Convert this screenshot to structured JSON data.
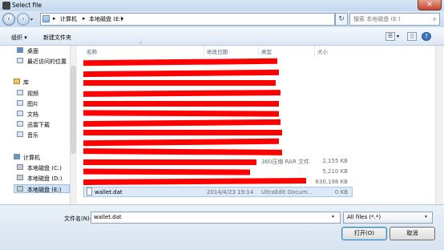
{
  "window": {
    "title": "Select file",
    "close_glyph": "✕"
  },
  "nav": {
    "back_icon": "‹",
    "forward_icon": "›",
    "history_icon": "▾",
    "breadcrumbs": [
      "计算机",
      "本地磁盘 (E:)"
    ],
    "sep": "▸",
    "refresh_icon": "↻",
    "search_placeholder": "搜索 本地磁盘 (E:)",
    "search_icon": "⌕"
  },
  "toolbar": {
    "organize_label": "组织 ▾",
    "new_folder_label": "新建文件夹",
    "view_icon": "☰",
    "view_arrow": "▾",
    "pane_icon": "▯",
    "help_icon": "?"
  },
  "sidebar": {
    "favorites": [
      {
        "label": "桌面",
        "icon": "desktop-icon"
      },
      {
        "label": "最近访问的位置",
        "icon": "recent-places-icon"
      }
    ],
    "libraries_header": "库",
    "libraries": [
      {
        "label": "视频",
        "icon": "video-icon"
      },
      {
        "label": "图片",
        "icon": "pictures-icon"
      },
      {
        "label": "文档",
        "icon": "documents-icon"
      },
      {
        "label": "迅雷下载",
        "icon": "thunder-download-icon"
      },
      {
        "label": "音乐",
        "icon": "music-icon"
      }
    ],
    "computer_header": "计算机",
    "drives": [
      {
        "label": "本地磁盘 (C:)"
      },
      {
        "label": "本地磁盘 (D:)"
      },
      {
        "label": "本地磁盘 (E:)",
        "selected": true
      }
    ]
  },
  "columns": {
    "name": "名称",
    "modified": "修改日期",
    "type": "类型",
    "size": "大小",
    "sort_glyph": "^"
  },
  "files": [
    {
      "name": "",
      "modified": "",
      "type": "360压缩 RAR 文件",
      "size": "2,155 KB"
    },
    {
      "name": "",
      "modified": "",
      "type": "",
      "size": "5,210 KB"
    },
    {
      "name": "",
      "modified": "",
      "type": "",
      "size": "830,198 KB"
    },
    {
      "name": "wallet.dat",
      "modified": "2014/4/23 19:14",
      "type": "UltraEdit Docum...",
      "size": "0 KB",
      "selected": true
    }
  ],
  "bottom": {
    "filename_label": "文件名(N):",
    "filename_value": "wallet.dat",
    "dropdown_arrow": "▾",
    "filetype_value": "All files (*.*)",
    "open_label": "打开(O)",
    "cancel_label": "取消"
  },
  "colors": {
    "redaction": "#ff0000",
    "selection": "#dbe9f8",
    "titlebar": "#c4d7ee"
  }
}
